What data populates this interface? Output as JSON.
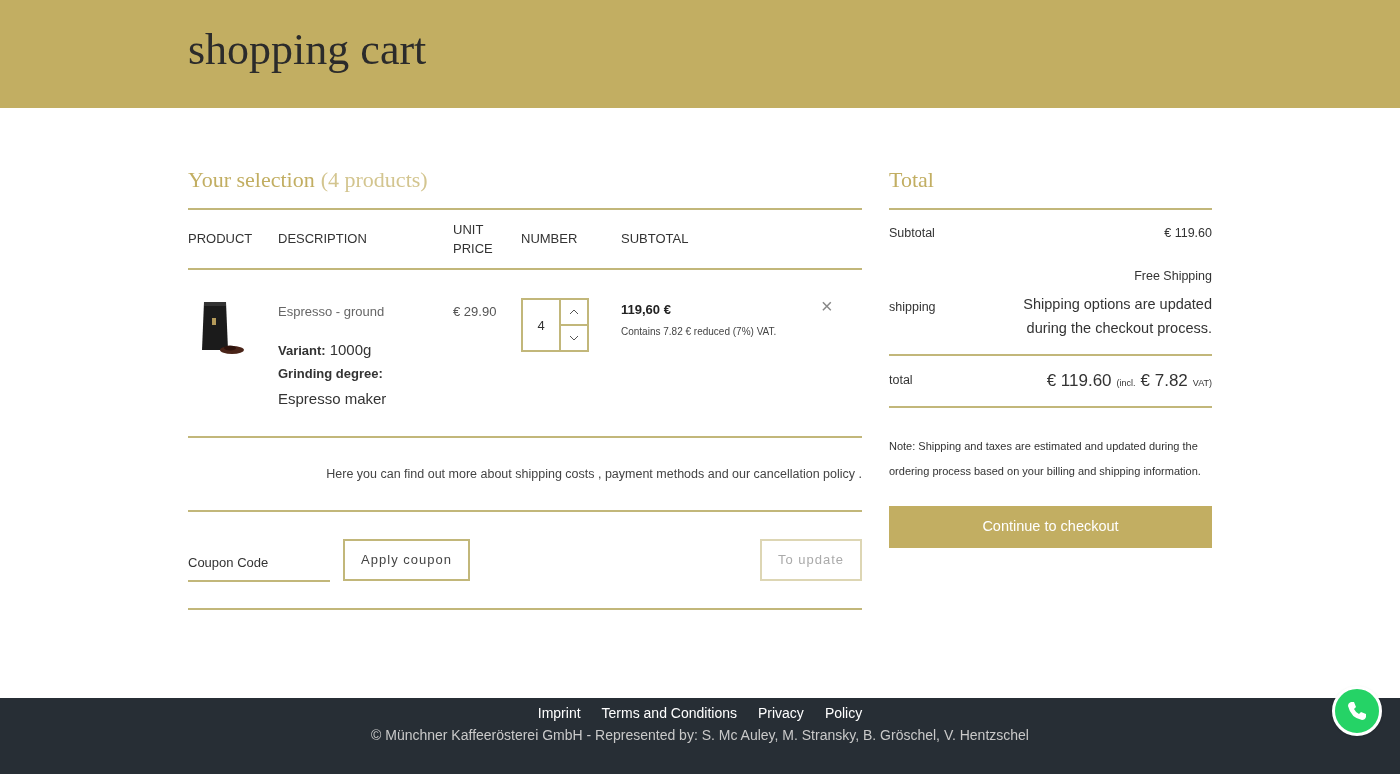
{
  "header": {
    "title": "shopping cart"
  },
  "selection": {
    "title": "Your selection",
    "count": "(4 products)"
  },
  "table": {
    "columns": [
      "PRODUCT",
      "DESCRIPTION",
      "UNIT PRICE",
      "NUMBER",
      "SUBTOTAL"
    ],
    "rows": [
      {
        "name": "Espresso - ground",
        "variant_label": "Variant:",
        "variant": "1000g",
        "grind_label": "Grinding degree:",
        "grind": "Espresso maker",
        "unit_price": "€ 29.90",
        "quantity": "4",
        "subtotal": "119,60 €",
        "tax_note": "Contains 7.82 € reduced (7%) VAT.",
        "remove": "×"
      }
    ]
  },
  "info": "Here you can find out more about shipping costs , payment methods and our cancellation policy .",
  "coupon": {
    "placeholder": "Coupon Code",
    "apply": "Apply coupon",
    "update": {
      "label": "To update",
      "disabled": true
    }
  },
  "totals": {
    "title": "Total",
    "subtotal_label": "Subtotal",
    "subtotal": "€ 119.60",
    "shipping_label": "shipping",
    "shipping_method": "Free Shipping",
    "shipping_note": "Shipping options are updated during the checkout process.",
    "total_label": "total",
    "total": "€ 119.60",
    "incl": "(incl.",
    "vat_amount": "€ 7.82",
    "vat": "VAT)",
    "note": "Note: Shipping and taxes are estimated and updated during the ordering process based on your billing and shipping information.",
    "checkout": "Continue to checkout"
  },
  "footer": {
    "links": [
      "Imprint",
      "Terms and Conditions",
      "Privacy",
      "Policy"
    ],
    "copyright": "© Münchner Kaffeerösterei GmbH - Represented by: S. Mc Auley, M. Stransky, B. Gröschel, V. Hentzschel"
  }
}
